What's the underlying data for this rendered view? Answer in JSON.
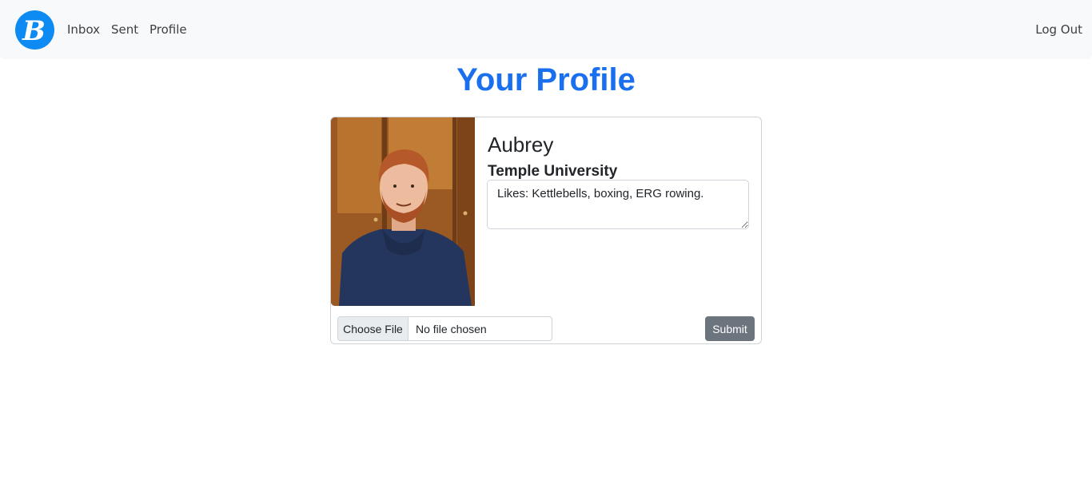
{
  "nav": {
    "logo_letter": "B",
    "links": [
      "Inbox",
      "Sent",
      "Profile"
    ],
    "logout": "Log Out"
  },
  "page": {
    "title": "Your Profile"
  },
  "profile": {
    "name": "Aubrey",
    "school": "Temple University",
    "bio": "Likes: Kettlebells, boxing, ERG rowing."
  },
  "upload": {
    "choose_label": "Choose File",
    "status": "No file chosen",
    "submit_label": "Submit"
  },
  "colors": {
    "brand": "#0d8bf2",
    "title": "#1a6fef",
    "navbar_bg": "#f8f9fa",
    "submit_bg": "#6c757d"
  }
}
